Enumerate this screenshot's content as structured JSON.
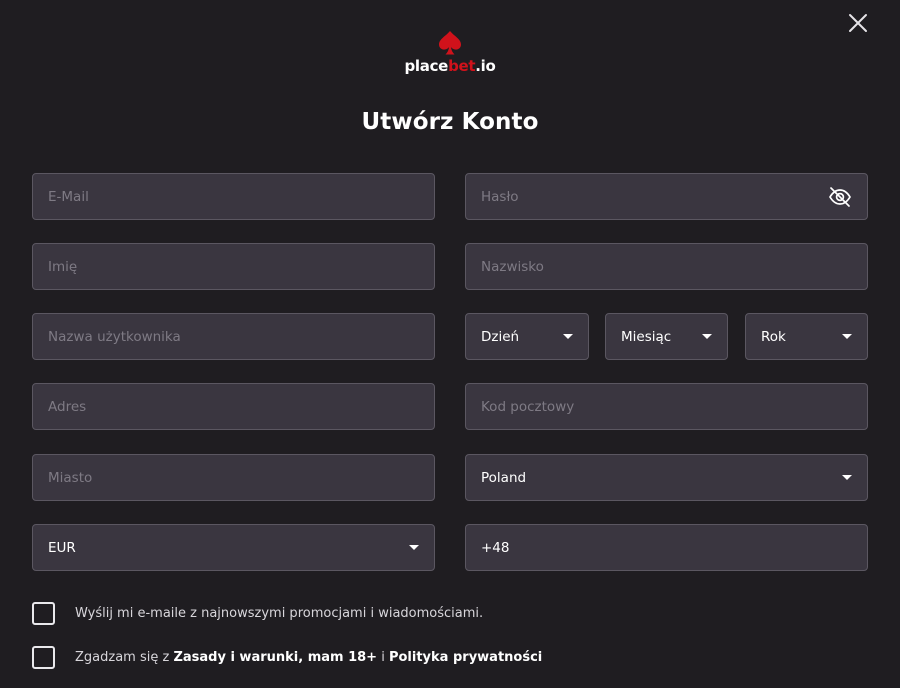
{
  "logo": {
    "part1": "place",
    "accent": "bet",
    "part2": ".io"
  },
  "title": "Utwórz Konto",
  "fields": {
    "email": {
      "placeholder": "E-Mail"
    },
    "password": {
      "placeholder": "Hasło"
    },
    "first_name": {
      "placeholder": "Imię"
    },
    "last_name": {
      "placeholder": "Nazwisko"
    },
    "username": {
      "placeholder": "Nazwa użytkownika"
    },
    "day": {
      "value": "Dzień"
    },
    "month": {
      "value": "Miesiąc"
    },
    "year": {
      "value": "Rok"
    },
    "address": {
      "placeholder": "Adres"
    },
    "postal_code": {
      "placeholder": "Kod pocztowy"
    },
    "city": {
      "placeholder": "Miasto"
    },
    "country": {
      "value": "Poland"
    },
    "currency": {
      "value": "EUR"
    },
    "phone_prefix": {
      "value": "+48"
    }
  },
  "consents": {
    "newsletter": "Wyślij mi e-maile z najnowszymi promocjami i wiadomościami.",
    "terms_prefix": "Zgadzam się z ",
    "terms_link": "Zasady i warunki, mam 18+",
    "terms_mid": " i ",
    "privacy_link": "Polityka prywatności"
  },
  "colors": {
    "background": "#1f1d21",
    "field": "#3a3640",
    "accent": "#d0121b"
  }
}
